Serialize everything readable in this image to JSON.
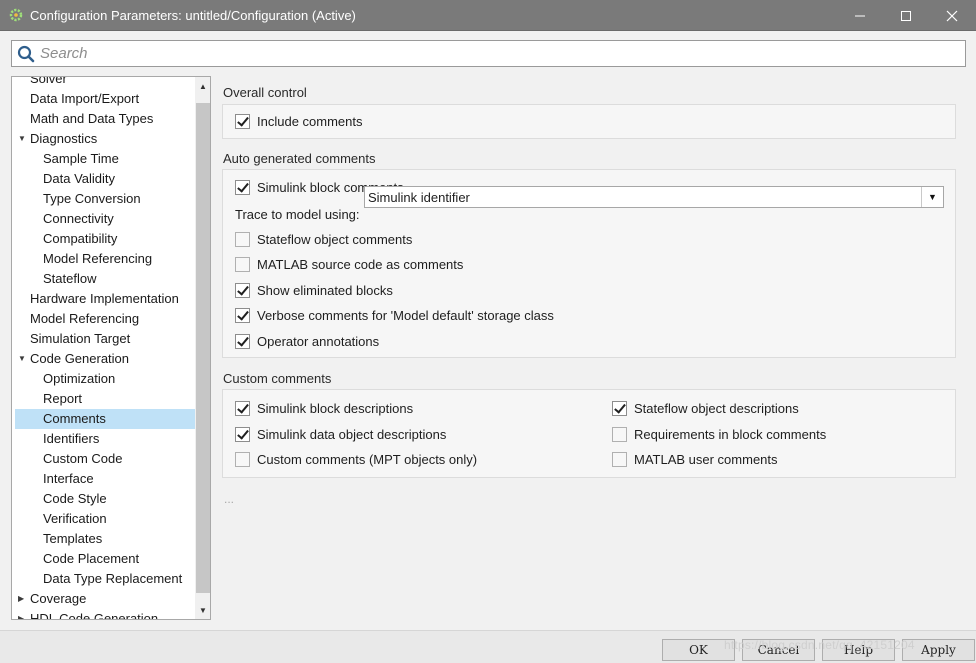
{
  "window": {
    "title": "Configuration Parameters: untitled/Configuration (Active)",
    "icons": {
      "app": "simulink-gear-icon",
      "minimize": "minimize-icon",
      "maximize": "maximize-icon",
      "close": "close-icon"
    }
  },
  "search": {
    "placeholder": "Search",
    "value": ""
  },
  "tree": {
    "items": [
      {
        "label": "Solver",
        "level": 0,
        "toggle": ""
      },
      {
        "label": "Data Import/Export",
        "level": 0,
        "toggle": ""
      },
      {
        "label": "Math and Data Types",
        "level": 0,
        "toggle": ""
      },
      {
        "label": "Diagnostics",
        "level": 0,
        "toggle": "▼"
      },
      {
        "label": "Sample Time",
        "level": 1,
        "toggle": ""
      },
      {
        "label": "Data Validity",
        "level": 1,
        "toggle": ""
      },
      {
        "label": "Type Conversion",
        "level": 1,
        "toggle": ""
      },
      {
        "label": "Connectivity",
        "level": 1,
        "toggle": ""
      },
      {
        "label": "Compatibility",
        "level": 1,
        "toggle": ""
      },
      {
        "label": "Model Referencing",
        "level": 1,
        "toggle": ""
      },
      {
        "label": "Stateflow",
        "level": 1,
        "toggle": ""
      },
      {
        "label": "Hardware Implementation",
        "level": 0,
        "toggle": ""
      },
      {
        "label": "Model Referencing",
        "level": 0,
        "toggle": ""
      },
      {
        "label": "Simulation Target",
        "level": 0,
        "toggle": ""
      },
      {
        "label": "Code Generation",
        "level": 0,
        "toggle": "▼"
      },
      {
        "label": "Optimization",
        "level": 1,
        "toggle": ""
      },
      {
        "label": "Report",
        "level": 1,
        "toggle": ""
      },
      {
        "label": "Comments",
        "level": 1,
        "toggle": "",
        "selected": true
      },
      {
        "label": "Identifiers",
        "level": 1,
        "toggle": ""
      },
      {
        "label": "Custom Code",
        "level": 1,
        "toggle": ""
      },
      {
        "label": "Interface",
        "level": 1,
        "toggle": ""
      },
      {
        "label": "Code Style",
        "level": 1,
        "toggle": ""
      },
      {
        "label": "Verification",
        "level": 1,
        "toggle": ""
      },
      {
        "label": "Templates",
        "level": 1,
        "toggle": ""
      },
      {
        "label": "Code Placement",
        "level": 1,
        "toggle": ""
      },
      {
        "label": "Data Type Replacement",
        "level": 1,
        "toggle": ""
      },
      {
        "label": "Coverage",
        "level": 0,
        "toggle": "▶"
      },
      {
        "label": "HDL Code Generation",
        "level": 0,
        "toggle": "▶"
      }
    ],
    "scroll_up": "▲",
    "scroll_down": "▼"
  },
  "overall": {
    "title": "Overall control",
    "include_comments": {
      "label": "Include comments",
      "checked": true
    }
  },
  "auto": {
    "title": "Auto generated comments",
    "simulink_block_comments": {
      "label": "Simulink block comments",
      "checked": true
    },
    "trace_label": "Trace to model using:",
    "trace_value": "Simulink identifier",
    "trace_dropdown": "▼",
    "stateflow_object_comments": {
      "label": "Stateflow object comments",
      "checked": false
    },
    "matlab_source_code": {
      "label": "MATLAB source code as comments",
      "checked": false
    },
    "show_eliminated_blocks": {
      "label": "Show eliminated blocks",
      "checked": true
    },
    "verbose_comments": {
      "label": "Verbose comments for 'Model default' storage class",
      "checked": true
    },
    "operator_annotations": {
      "label": "Operator annotations",
      "checked": true
    }
  },
  "custom": {
    "title": "Custom comments",
    "simulink_block_descriptions": {
      "label": "Simulink block descriptions",
      "checked": true
    },
    "simulink_data_object_descriptions": {
      "label": "Simulink data object descriptions",
      "checked": true
    },
    "custom_comments_mpt": {
      "label": "Custom comments (MPT objects only)",
      "checked": false
    },
    "stateflow_object_descriptions": {
      "label": "Stateflow object descriptions",
      "checked": true
    },
    "requirements_in_block_comments": {
      "label": "Requirements in block comments",
      "checked": false
    },
    "matlab_user_comments": {
      "label": "MATLAB user comments",
      "checked": false
    }
  },
  "ellipsis": "...",
  "buttons": {
    "ok": "OK",
    "cancel": "Cancel",
    "help": "Help",
    "apply": "Apply"
  },
  "watermark": "https://blog.csdn.net/qq_42151204"
}
